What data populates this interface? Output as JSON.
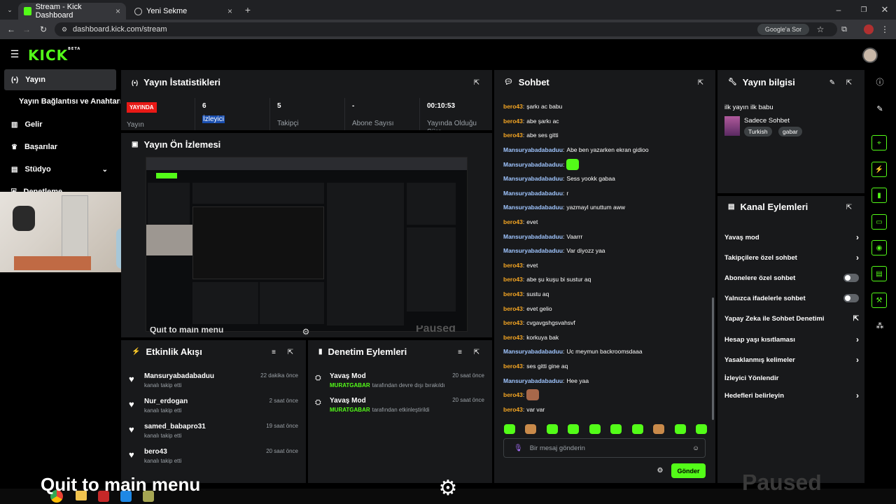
{
  "browser": {
    "tabs": [
      {
        "label": "Stream - Kick Dashboard"
      },
      {
        "label": "Yeni Sekme"
      }
    ],
    "url": "dashboard.kick.com/stream",
    "google_btn": "Google'a Sor"
  },
  "app": {
    "logo": "KICK",
    "logo_badge": "BETA"
  },
  "sidebar": {
    "items": [
      {
        "label": "Yayın"
      },
      {
        "label": "Yayın Bağlantısı ve Anahtarı"
      },
      {
        "label": "Gelir"
      },
      {
        "label": "Başarılar"
      },
      {
        "label": "Stüdyo"
      },
      {
        "label": "Denetleme"
      }
    ]
  },
  "stats": {
    "title": "Yayın İstatistikleri",
    "live_badge": "YAYINDA",
    "live_label": "Yayın",
    "items": [
      {
        "value": "6",
        "label": "İzleyici"
      },
      {
        "value": "5",
        "label": "Takipçi"
      },
      {
        "value": "-",
        "label": "Abone Sayısı"
      },
      {
        "value": "00:10:53",
        "label": "Yayında Olduğu Süre"
      }
    ]
  },
  "preview": {
    "title": "Yayın Ön İzlemesi",
    "overlay_text": "Quit to main menu",
    "paused_text": "Paused"
  },
  "activity": {
    "title": "Etkinlik Akışı",
    "items": [
      {
        "name": "Mansuryabadabaduu",
        "sub": "kanalı takip etti",
        "time": "22 dakika önce"
      },
      {
        "name": "Nur_erdogan",
        "sub": "kanalı takip etti",
        "time": "2 saat önce"
      },
      {
        "name": "samed_babapro31",
        "sub": "kanalı takip etti",
        "time": "19 saat önce"
      },
      {
        "name": "bero43",
        "sub": "kanalı takip etti",
        "time": "20 saat önce"
      }
    ]
  },
  "moderation": {
    "title": "Denetim Eylemleri",
    "items": [
      {
        "name": "Yavaş Mod",
        "user": "MURATGABAR",
        "text": "tarafından devre dışı bırakıldı",
        "time": "20 saat önce"
      },
      {
        "name": "Yavaş Mod",
        "user": "MURATGABAR",
        "text": "tarafından etkinleştirildi",
        "time": "20 saat önce"
      }
    ]
  },
  "chat": {
    "title": "Sohbet",
    "messages": [
      {
        "user": "bero43",
        "text": "şarkı ac babu"
      },
      {
        "user": "bero43",
        "text": "abe şarkı ac"
      },
      {
        "user": "bero43",
        "text": "abe ses gitti"
      },
      {
        "user": "Mansuryabadabaduu",
        "text": "Abe ben yazarken ekran gidioo"
      },
      {
        "user": "Mansuryabadabaduu",
        "text": ""
      },
      {
        "user": "Mansuryabadabaduu",
        "text": "Sess yookk gabaa"
      },
      {
        "user": "Mansuryabadabaduu",
        "text": "r"
      },
      {
        "user": "Mansuryabadabaduu",
        "text": "yazmayl unuttum aww"
      },
      {
        "user": "bero43",
        "text": "evet"
      },
      {
        "user": "Mansuryabadabaduu",
        "text": "Vaarrr"
      },
      {
        "user": "Mansuryabadabaduu",
        "text": "Var diyozz yaa"
      },
      {
        "user": "bero43",
        "text": "evet"
      },
      {
        "user": "bero43",
        "text": "abe şu kuşu bi sustur aq"
      },
      {
        "user": "bero43",
        "text": "sustu aq"
      },
      {
        "user": "bero43",
        "text": "evet gelio"
      },
      {
        "user": "bero43",
        "text": "cvgavgshgsvahsvf"
      },
      {
        "user": "bero43",
        "text": "korkuya bak"
      },
      {
        "user": "Mansuryabadabaduu",
        "text": "Uc meymun backroomsdaaa"
      },
      {
        "user": "bero43",
        "text": "ses gitti gine aq"
      },
      {
        "user": "Mansuryabadabaduu",
        "text": "Hee yaa"
      },
      {
        "user": "bero43",
        "text": ""
      },
      {
        "user": "bero43",
        "text": "var var"
      }
    ],
    "placeholder": "Bir mesaj gönderin",
    "send": "Gönder",
    "colors": {
      "bero": "#f5a623",
      "mansur": "#9fc5ff",
      "accent": "#53fc18"
    }
  },
  "info": {
    "title": "Yayın bilgisi",
    "stream_title": "ilk yayın ilk babu",
    "category": "Sadece Sohbet",
    "tags": [
      "Turkish",
      "gabar"
    ]
  },
  "channel": {
    "title": "Kanal Eylemleri",
    "items": [
      {
        "label": "Yavaş mod",
        "kind": "chevron"
      },
      {
        "label": "Takipçilere özel sohbet",
        "kind": "chevron"
      },
      {
        "label": "Abonelere özel sohbet",
        "kind": "toggle"
      },
      {
        "label": "Yalnızca ifadelerle sohbet",
        "kind": "toggle"
      },
      {
        "label": "Yapay Zeka ile Sohbet Denetimi",
        "kind": "external"
      },
      {
        "label": "Hesap yaşı kısıtlaması",
        "kind": "chevron"
      },
      {
        "label": "Yasaklanmış kelimeler",
        "kind": "chevron"
      },
      {
        "label": "İzleyici Yönlendir",
        "kind": "none"
      },
      {
        "label": "Hedefleri belirleyin",
        "kind": "chevron"
      }
    ]
  },
  "overlay": {
    "bottom_text": "Quit to main menu"
  }
}
